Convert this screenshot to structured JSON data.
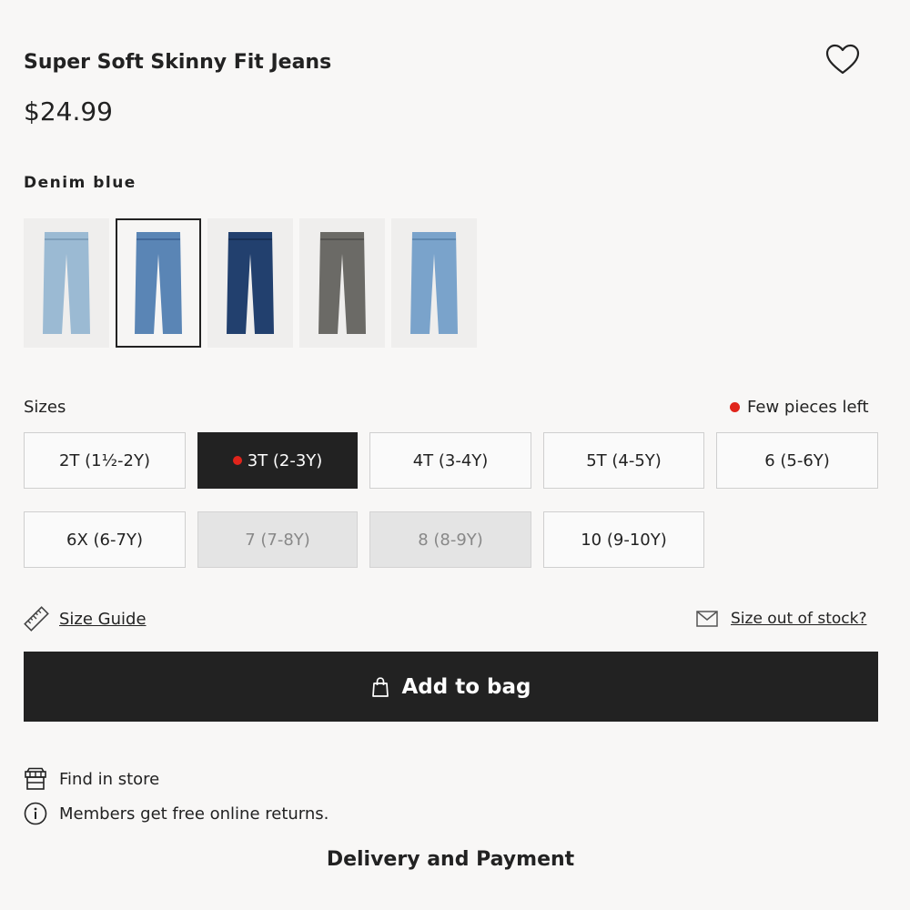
{
  "product": {
    "title": "Super Soft Skinny Fit Jeans",
    "price": "$24.99",
    "color_name": "Denim blue"
  },
  "swatches": [
    {
      "name": "light-denim",
      "color": "#9bbad3",
      "selected": false
    },
    {
      "name": "denim-blue",
      "color": "#5a85b5",
      "selected": true
    },
    {
      "name": "dark-denim",
      "color": "#22406e",
      "selected": false
    },
    {
      "name": "grey",
      "color": "#6b6a66",
      "selected": false
    },
    {
      "name": "mid-denim",
      "color": "#7aa3cb",
      "selected": false
    }
  ],
  "sizes": {
    "label": "Sizes",
    "few_left": "Few pieces left",
    "options": [
      "2T (1½-2Y)",
      "3T (2-3Y)",
      "4T (3-4Y)",
      "5T (4-5Y)",
      "6 (5-6Y)",
      "6X (6-7Y)",
      "7 (7-8Y)",
      "8 (8-9Y)",
      "10 (9-10Y)"
    ]
  },
  "links": {
    "size_guide": "Size Guide",
    "size_out_of_stock": "Size out of stock?"
  },
  "actions": {
    "add_to_bag": "Add to bag"
  },
  "info": {
    "find_in_store": "Find in store",
    "free_returns": "Members get free online returns."
  },
  "sections": {
    "delivery": "Delivery and Payment"
  },
  "colors": {
    "accent_dark": "#222222",
    "low_stock": "#e0241b"
  }
}
